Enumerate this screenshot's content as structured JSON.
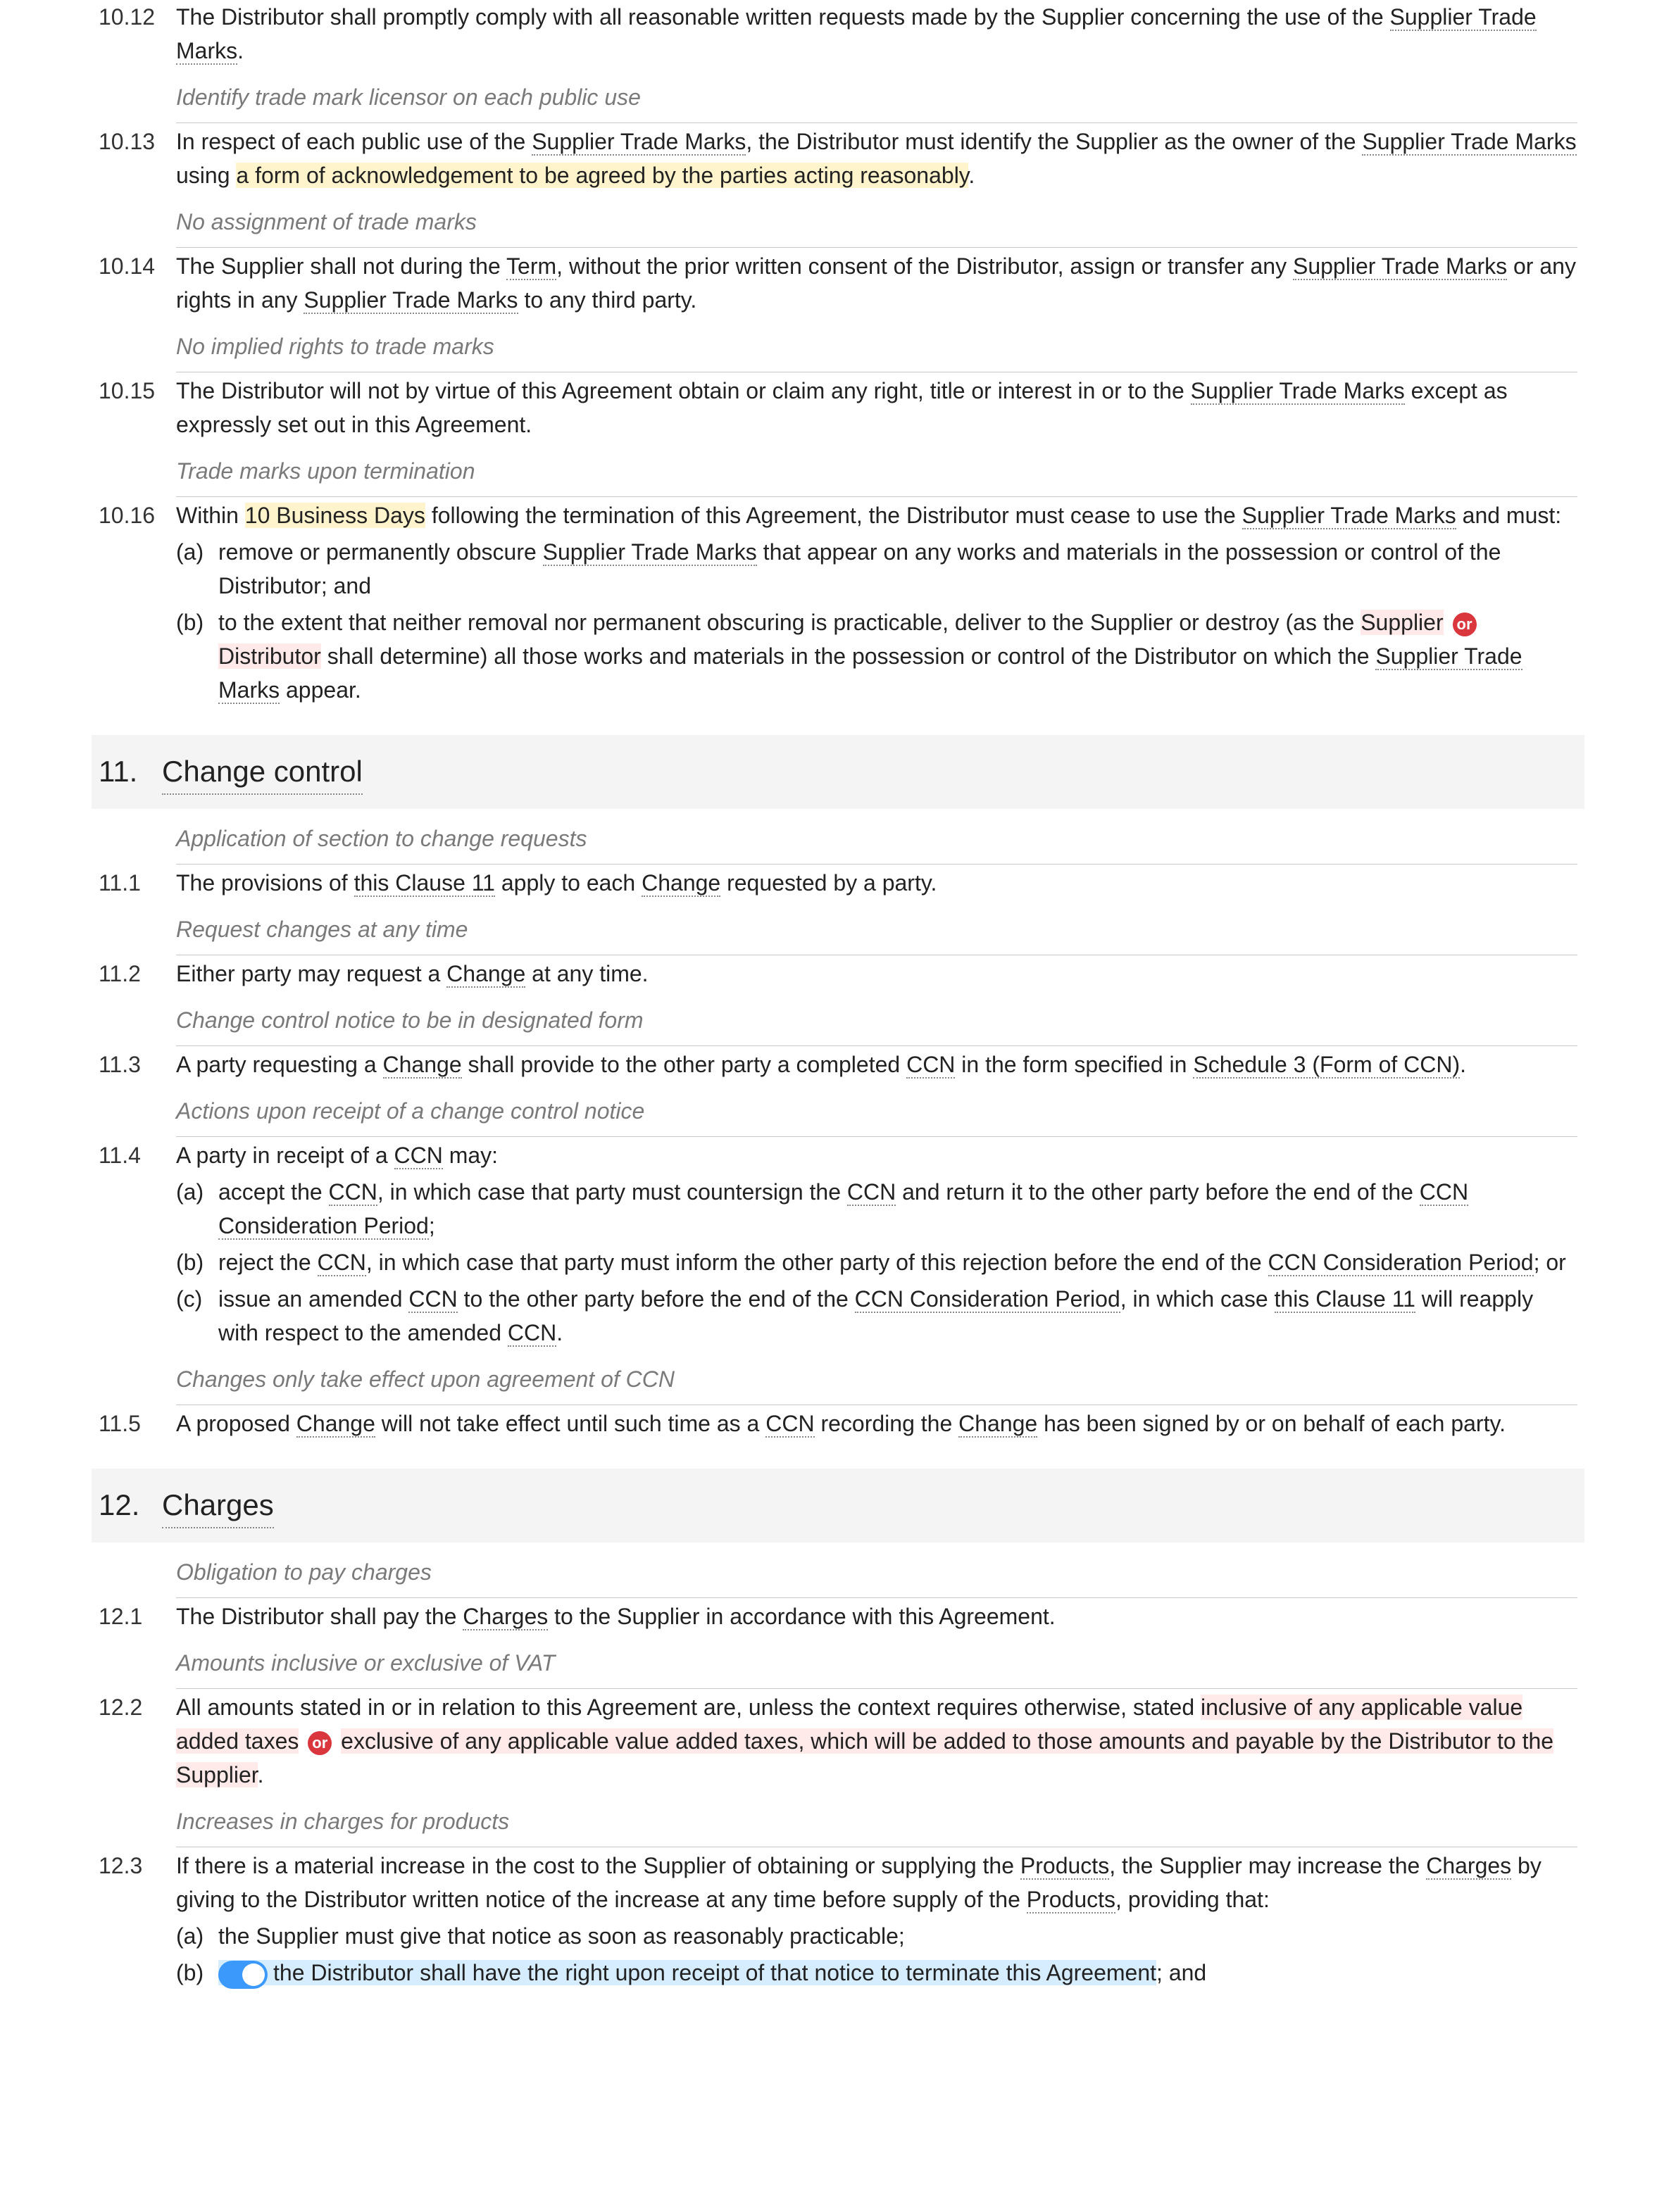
{
  "c10_12_num": "10.12",
  "c10_12_p1": "The Distributor shall promptly comply with all reasonable written requests made by the Supplier concerning the use of the ",
  "c10_12_stm": "Supplier Trade Marks",
  "c10_12_p2": ".",
  "cap10_13": "Identify trade mark licensor on each public use",
  "c10_13_num": "10.13",
  "c10_13_p1": "In respect of each public use of the ",
  "c10_13_stm1": "Supplier Trade Marks",
  "c10_13_p2": ", the Distributor must identify the Supplier as the owner of the ",
  "c10_13_stm2": "Supplier Trade Marks",
  "c10_13_p3": " using ",
  "c10_13_hl": "a form of acknowledgement to be agreed by the parties acting reasonably",
  "c10_13_p4": ".",
  "cap10_14": "No assignment of trade marks",
  "c10_14_num": "10.14",
  "c10_14_p1": "The Supplier shall not during the ",
  "c10_14_term": "Term",
  "c10_14_p2": ", without the prior written consent of the Distributor, assign or transfer any ",
  "c10_14_stm1": "Supplier Trade Marks",
  "c10_14_p3": " or any rights in any ",
  "c10_14_stm2": "Supplier Trade Marks",
  "c10_14_p4": " to any third party.",
  "cap10_15": "No implied rights to trade marks",
  "c10_15_num": "10.15",
  "c10_15_p1": "The Distributor will not by virtue of this Agreement obtain or claim any right, title or interest in or to the ",
  "c10_15_stm": "Supplier Trade Marks",
  "c10_15_p2": " except as expressly set out in this Agreement.",
  "cap10_16": "Trade marks upon termination",
  "c10_16_num": "10.16",
  "c10_16_p1": "Within ",
  "c10_16_hl": "10 Business Days",
  "c10_16_p2": " following the termination of this Agreement, the Distributor must cease to use the ",
  "c10_16_stm": "Supplier Trade Marks",
  "c10_16_p3": " and must:",
  "c10_16_a_l": "(a)",
  "c10_16_a_p1": "remove or permanently obscure ",
  "c10_16_a_stm": "Supplier Trade Marks",
  "c10_16_a_p2": " that appear on any works and materials in the possession or control of the Distributor; and",
  "c10_16_b_l": "(b)",
  "c10_16_b_p1": "to the extent that neither removal nor permanent obscuring is practicable, deliver to the Supplier or destroy (as the ",
  "c10_16_b_h1": "Supplier",
  "c10_16_b_or": "or",
  "c10_16_b_h2": "Distributor",
  "c10_16_b_p2": " shall determine) all those works and materials in the possession or control of the Distributor on which the ",
  "c10_16_b_stm": "Supplier Trade Marks",
  "c10_16_b_p3": " appear.",
  "sec11_num": "11.",
  "sec11_title": "Change control",
  "cap11_1": "Application of section to change requests",
  "c11_1_num": "11.1",
  "c11_1_p1": "The provisions of ",
  "c11_1_t1": "this Clause 11",
  "c11_1_p2": " apply to each ",
  "c11_1_t2": "Change",
  "c11_1_p3": " requested by a party.",
  "cap11_2": "Request changes at any time",
  "c11_2_num": "11.2",
  "c11_2_p1": "Either party may request a ",
  "c11_2_t1": "Change",
  "c11_2_p2": " at any time.",
  "cap11_3": "Change control notice to be in designated form",
  "c11_3_num": "11.3",
  "c11_3_p1": "A party requesting a ",
  "c11_3_t1": "Change",
  "c11_3_p2": " shall provide to the other party a completed ",
  "c11_3_t2": "CCN",
  "c11_3_p3": " in the form specified in ",
  "c11_3_t3": "Schedule 3 (Form of CCN)",
  "c11_3_p4": ".",
  "cap11_4": "Actions upon receipt of a change control notice",
  "c11_4_num": "11.4",
  "c11_4_p1": "A party in receipt of a ",
  "c11_4_t1": "CCN",
  "c11_4_p2": " may:",
  "c11_4_a_l": "(a)",
  "c11_4_a_p1": "accept the ",
  "c11_4_a_t1": "CCN",
  "c11_4_a_p2": ", in which case that party must countersign the ",
  "c11_4_a_t2": "CCN",
  "c11_4_a_p3": " and return it to the other party before the end of the ",
  "c11_4_a_t3": "CCN Consideration Period",
  "c11_4_a_p4": ";",
  "c11_4_b_l": "(b)",
  "c11_4_b_p1": "reject the ",
  "c11_4_b_t1": "CCN",
  "c11_4_b_p2": ", in which case that party must inform the other party of this rejection before the end of the ",
  "c11_4_b_t2": "CCN Consideration Period",
  "c11_4_b_p3": "; or",
  "c11_4_c_l": "(c)",
  "c11_4_c_p1": "issue an amended ",
  "c11_4_c_t1": "CCN",
  "c11_4_c_p2": " to the other party before the end of the ",
  "c11_4_c_t2": "CCN Consideration Period",
  "c11_4_c_p3": ", in which case ",
  "c11_4_c_t3": "this Clause 11",
  "c11_4_c_p4": " will reapply with respect to the amended ",
  "c11_4_c_t4": "CCN",
  "c11_4_c_p5": ".",
  "cap11_5": "Changes only take effect upon agreement of CCN",
  "c11_5_num": "11.5",
  "c11_5_p1": "A proposed ",
  "c11_5_t1": "Change",
  "c11_5_p2": " will not take effect until such time as a ",
  "c11_5_t2": "CCN",
  "c11_5_p3": " recording the ",
  "c11_5_t3": "Change",
  "c11_5_p4": " has been signed by or on behalf of each party.",
  "sec12_num": "12.",
  "sec12_title": "Charges",
  "cap12_1": "Obligation to pay charges",
  "c12_1_num": "12.1",
  "c12_1_p1": "The Distributor shall pay the ",
  "c12_1_t1": "Charges",
  "c12_1_p2": " to the Supplier in accordance with this Agreement.",
  "cap12_2": "Amounts inclusive or exclusive of VAT",
  "c12_2_num": "12.2",
  "c12_2_p1": "All amounts stated in or in relation to this Agreement are, unless the context requires otherwise, stated ",
  "c12_2_h1": "inclusive of any applicable value added taxes",
  "c12_2_or": "or",
  "c12_2_h2": "exclusive of any applicable value added taxes, which will be added to those amounts and payable by the Distributor to the Supplier",
  "c12_2_p2": ".",
  "cap12_3": "Increases in charges for products",
  "c12_3_num": "12.3",
  "c12_3_p1": "If there is a material increase in the cost to the Supplier of obtaining or supplying the ",
  "c12_3_t1": "Products",
  "c12_3_p2": ", the Supplier may increase the ",
  "c12_3_t2": "Charges",
  "c12_3_p3": " by giving to the Distributor written notice of the increase at any time before supply of the ",
  "c12_3_t3": "Products",
  "c12_3_p4": ", providing that:",
  "c12_3_a_l": "(a)",
  "c12_3_a_p1": "the Supplier must give that notice as soon as reasonably practicable;",
  "c12_3_b_l": "(b)",
  "c12_3_b_h1": "the Distributor shall have the right upon receipt of that notice to terminate this Agreement",
  "c12_3_b_p2": "; and"
}
